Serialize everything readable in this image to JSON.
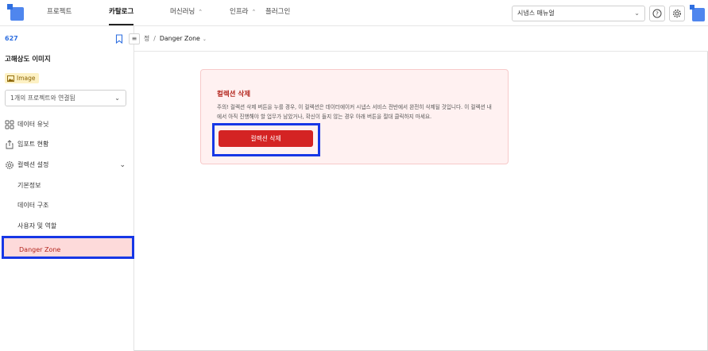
{
  "topnav": {
    "items": [
      {
        "label": "프로젝트",
        "active": false,
        "has_chevron": false
      },
      {
        "label": "카탈로그",
        "active": true,
        "has_chevron": false
      },
      {
        "label": "머신러닝",
        "active": false,
        "has_chevron": true
      },
      {
        "label": "인프라",
        "active": false,
        "has_chevron": true
      },
      {
        "label": "플러그인",
        "active": false,
        "has_chevron": false
      }
    ],
    "manual_select_value": "시냅스 매뉴얼",
    "help_icon": "question-circle-icon",
    "settings_icon": "gear-icon"
  },
  "sidebar": {
    "collection_id": "627",
    "collection_title": "고해상도 이미지",
    "type_badge": "Image",
    "project_select_value": "1개의 프로젝트와 연결됨",
    "menu": [
      {
        "label": "데이터 유닛",
        "icon": "grid-icon"
      },
      {
        "label": "임포트 현황",
        "icon": "import-icon"
      },
      {
        "label": "컬렉션 설정",
        "icon": "gear-icon",
        "expanded": true
      }
    ],
    "sub_items": [
      {
        "label": "기본정보",
        "active": false
      },
      {
        "label": "데이터 구조",
        "active": false
      },
      {
        "label": "사용자 및 역할",
        "active": false
      },
      {
        "label": "Danger Zone",
        "active": true
      }
    ]
  },
  "breadcrumb": {
    "parent": "정",
    "separator": "/",
    "current": "Danger Zone"
  },
  "danger_zone": {
    "title": "컬렉션 삭제",
    "description": "주의! 컬렉션 삭제 버튼을 누를 경우, 이 컬렉션은 데이터에이커 시냅스 서비스 전반에서 완전히 삭제될 것입니다. 이 컬렉션 내에서 아직 진행해야 할 업무가 남았거나, 확신이 들지 않는 경우 아래 버튼을 절대 클릭하지 마세요.",
    "button_label": "컬렉션 삭제"
  },
  "colors": {
    "accent": "#2f6fe0",
    "danger": "#d42323",
    "danger_bg": "#fff1f1",
    "highlight": "#1737e6"
  }
}
